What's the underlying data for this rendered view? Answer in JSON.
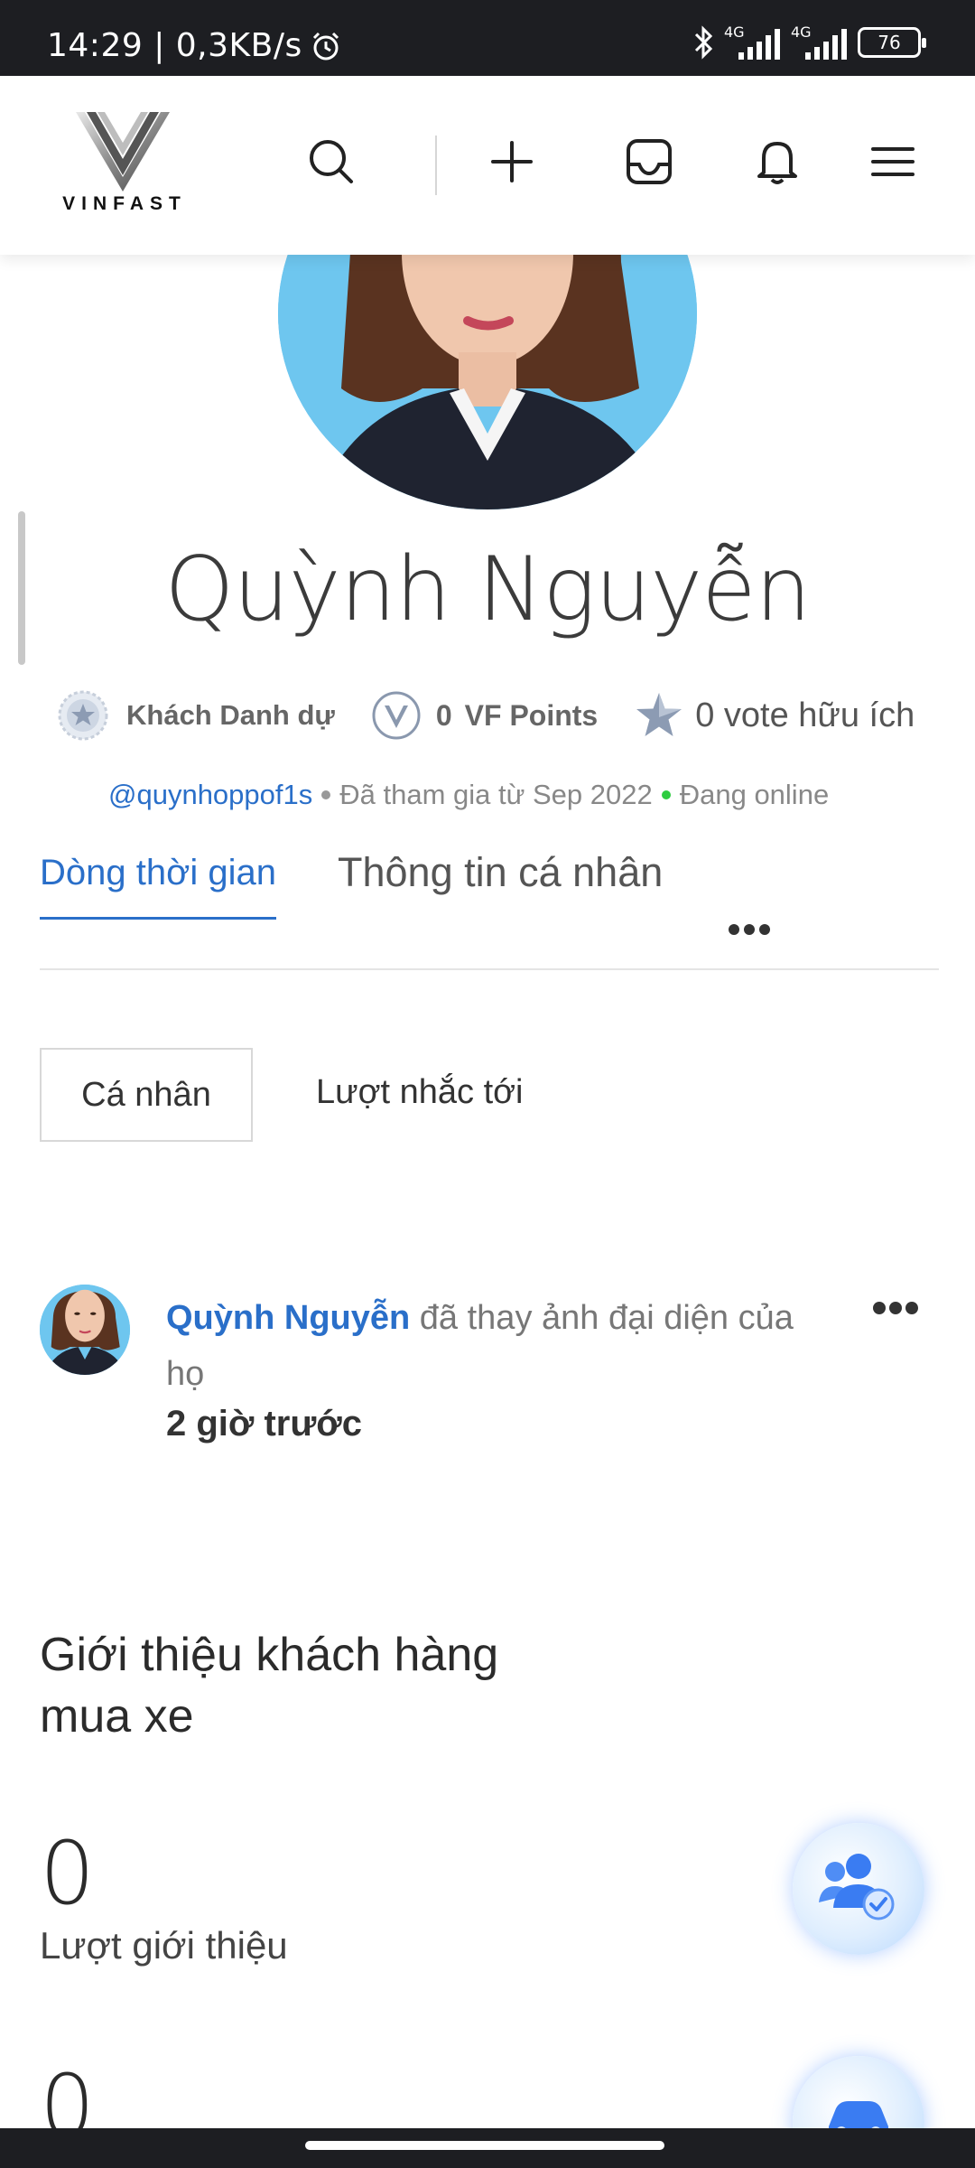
{
  "status_bar": {
    "time": "14:29 | 0,3KB/s",
    "network1": "4G",
    "network2": "4G",
    "battery": "76"
  },
  "header": {
    "brand": "VINFAST"
  },
  "profile": {
    "name": "Quỳnh Nguyễn",
    "rank": "Khách Danh dự",
    "points_value": "0",
    "points_label": "VF Points",
    "votes": "0 vote hữu ích",
    "handle": "@quynhoppof1s",
    "joined": "Đã tham gia từ Sep 2022",
    "online": "Đang online"
  },
  "tabs": {
    "timeline": "Dòng thời gian",
    "personal_info": "Thông tin cá nhân"
  },
  "subtabs": {
    "personal": "Cá nhân",
    "mentions": "Lượt nhắc tới"
  },
  "activity": {
    "user": "Quỳnh Nguyễn",
    "action": " đã thay ảnh đại diện của họ",
    "time": "2 giờ trước"
  },
  "referral": {
    "title": "Giới thiệu khách hàng mua xe",
    "count": "0",
    "count_label": "Lượt giới thiệu",
    "count2": "0"
  },
  "colors": {
    "accent": "#2a6fc9",
    "online": "#2ecc40"
  }
}
